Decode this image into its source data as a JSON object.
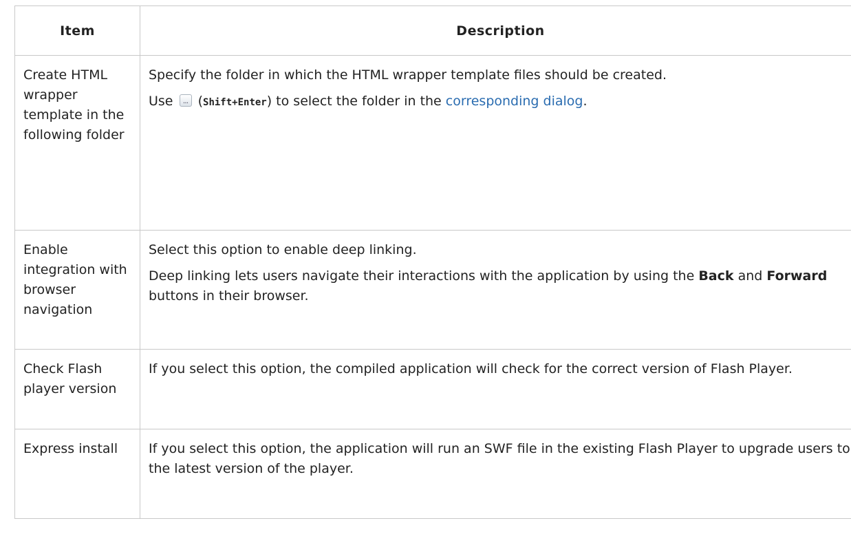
{
  "table": {
    "headers": {
      "item": "Item",
      "description": "Description"
    },
    "rows": [
      {
        "item": "Create HTML wrapper template in the following folder",
        "p1": "Specify the folder in which the HTML wrapper template files should be created.",
        "p2_pre": "Use",
        "p2_icon": "browse-button-icon",
        "p2_paren_open": "(",
        "p2_shortcut": "Shift+Enter",
        "p2_mid": ") to select the folder in the",
        "p2_link": "corresponding dialog",
        "p2_end": "."
      },
      {
        "item": "Enable integration with browser navigation",
        "p1": "Select this option to enable deep linking.",
        "p2_pre": "Deep linking lets users navigate their interactions with the application by using the",
        "p2_back": "Back",
        "p2_and": "and",
        "p2_forward": "Forward",
        "p2_end": "buttons in their browser."
      },
      {
        "item": "Check Flash player version",
        "p1": "If you select this option, the compiled application will check for the correct version of Flash Player."
      },
      {
        "item": "Express install",
        "p1": "If you select this option, the application will run an SWF file in the existing Flash Player to upgrade users to the latest version of the player."
      }
    ]
  }
}
